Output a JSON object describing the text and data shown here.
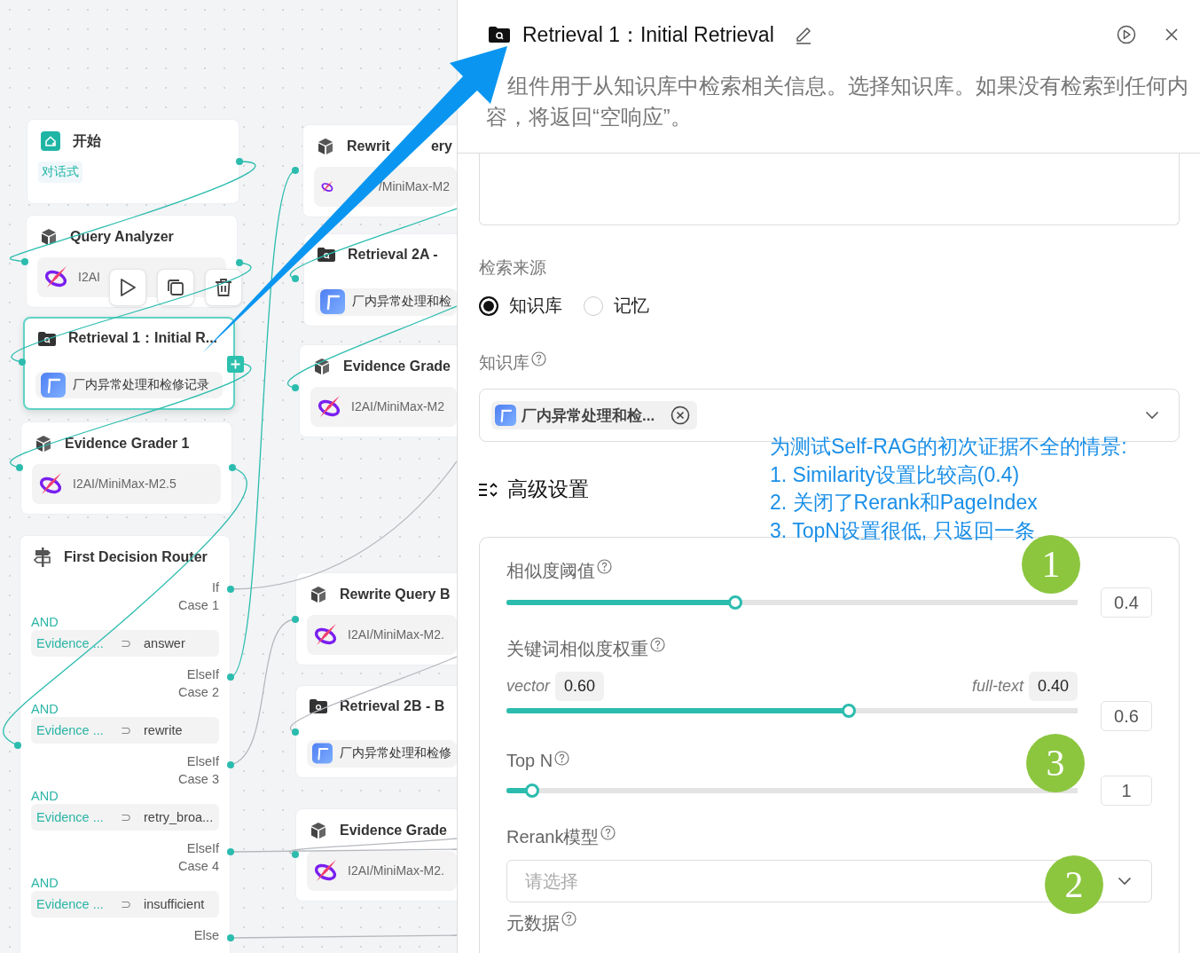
{
  "canvas": {
    "nodes": [
      {
        "kind": "start",
        "title": "开始",
        "tag": "对话式",
        "selected": false,
        "hovered": false
      },
      {
        "kind": "agent",
        "title": "Query Analyzer",
        "model": "I2AI",
        "selected": false,
        "hovered": true
      },
      {
        "kind": "retrieval",
        "title": "Retrieval 1：Initial R...",
        "knowledge_base": "厂内异常处理和检修记录",
        "selected": true,
        "hovered": false
      },
      {
        "kind": "agent",
        "title": "Evidence Grader 1",
        "model": "I2AI/MiniMax-M2.5",
        "selected": false,
        "hovered": false
      },
      {
        "kind": "router",
        "title": "First Decision Router",
        "selected": false,
        "hovered": false,
        "cases": [
          {
            "branch": "If",
            "case": "Case 1",
            "logic": "AND",
            "variable": "Evidence ...",
            "operator": "⊃",
            "value": "answer"
          },
          {
            "branch": "ElseIf",
            "case": "Case 2",
            "logic": "AND",
            "variable": "Evidence ...",
            "operator": "⊃",
            "value": "rewrite"
          },
          {
            "branch": "ElseIf",
            "case": "Case 3",
            "logic": "AND",
            "variable": "Evidence ...",
            "operator": "⊃",
            "value": "retry_broa..."
          },
          {
            "branch": "ElseIf",
            "case": "Case 4",
            "logic": "AND",
            "variable": "Evidence ...",
            "operator": "⊃",
            "value": "insufficient"
          }
        ],
        "else": "Else"
      },
      {
        "kind": "agent",
        "title_parts": [
          "Rewrit",
          "ery"
        ],
        "model": "/MiniMax-M2",
        "selected": false,
        "hovered": false
      },
      {
        "kind": "retrieval",
        "title": "Retrieval 2A -",
        "knowledge_base": "厂内异常处理和检",
        "selected": false,
        "hovered": false
      },
      {
        "kind": "agent",
        "title": "Evidence Grade",
        "model": "I2AI/MiniMax-M2",
        "selected": false,
        "hovered": false
      },
      {
        "kind": "agent",
        "title": "Rewrite Query B",
        "model": "I2AI/MiniMax-M2.",
        "selected": false,
        "hovered": false
      },
      {
        "kind": "retrieval",
        "title": "Retrieval 2B - B",
        "knowledge_base": "厂内异常处理和检修",
        "selected": false,
        "hovered": false
      },
      {
        "kind": "agent",
        "title": "Evidence Grade",
        "model": "I2AI/MiniMax-M2.",
        "selected": false,
        "hovered": false
      }
    ]
  },
  "panel": {
    "title": "Retrieval 1：Initial Retrieval",
    "description": "组件用于从知识库中检索相关信息。选择知识库。如果没有检索到任何内容，将返回“空响应”。",
    "source": {
      "label": "检索来源",
      "options": [
        {
          "label": "知识库",
          "selected": true
        },
        {
          "label": "记忆",
          "selected": false
        }
      ]
    },
    "knowledge_base": {
      "label": "知识库",
      "chips": [
        "厂内异常处理和检..."
      ]
    },
    "advanced": {
      "label": "高级设置",
      "settings": [
        {
          "kind": "slider",
          "label": "相似度阈值",
          "level": 0.4,
          "value": "0.4"
        },
        {
          "kind": "weight",
          "label": "关键词相似度权重",
          "left_label": "vector",
          "left_value": "0.60",
          "right_label": "full-text",
          "right_value": "0.40",
          "level": 0.6,
          "value": "0.6"
        },
        {
          "kind": "slider",
          "label": "Top N",
          "level": 0.045,
          "value": "1"
        },
        {
          "kind": "select",
          "label": "Rerank模型",
          "placeholder": "请选择"
        },
        {
          "kind": "label",
          "label": "元数据"
        }
      ]
    }
  },
  "annotations": {
    "note": [
      "为测试Self-RAG的初次证据不全的情景:",
      "1. Similarity设置比较高(0.4)",
      "2. 关闭了Rerank和PageIndex",
      "3. TopN设置很低, 只返回一条"
    ],
    "badges": [
      "1",
      "3",
      "2"
    ]
  }
}
